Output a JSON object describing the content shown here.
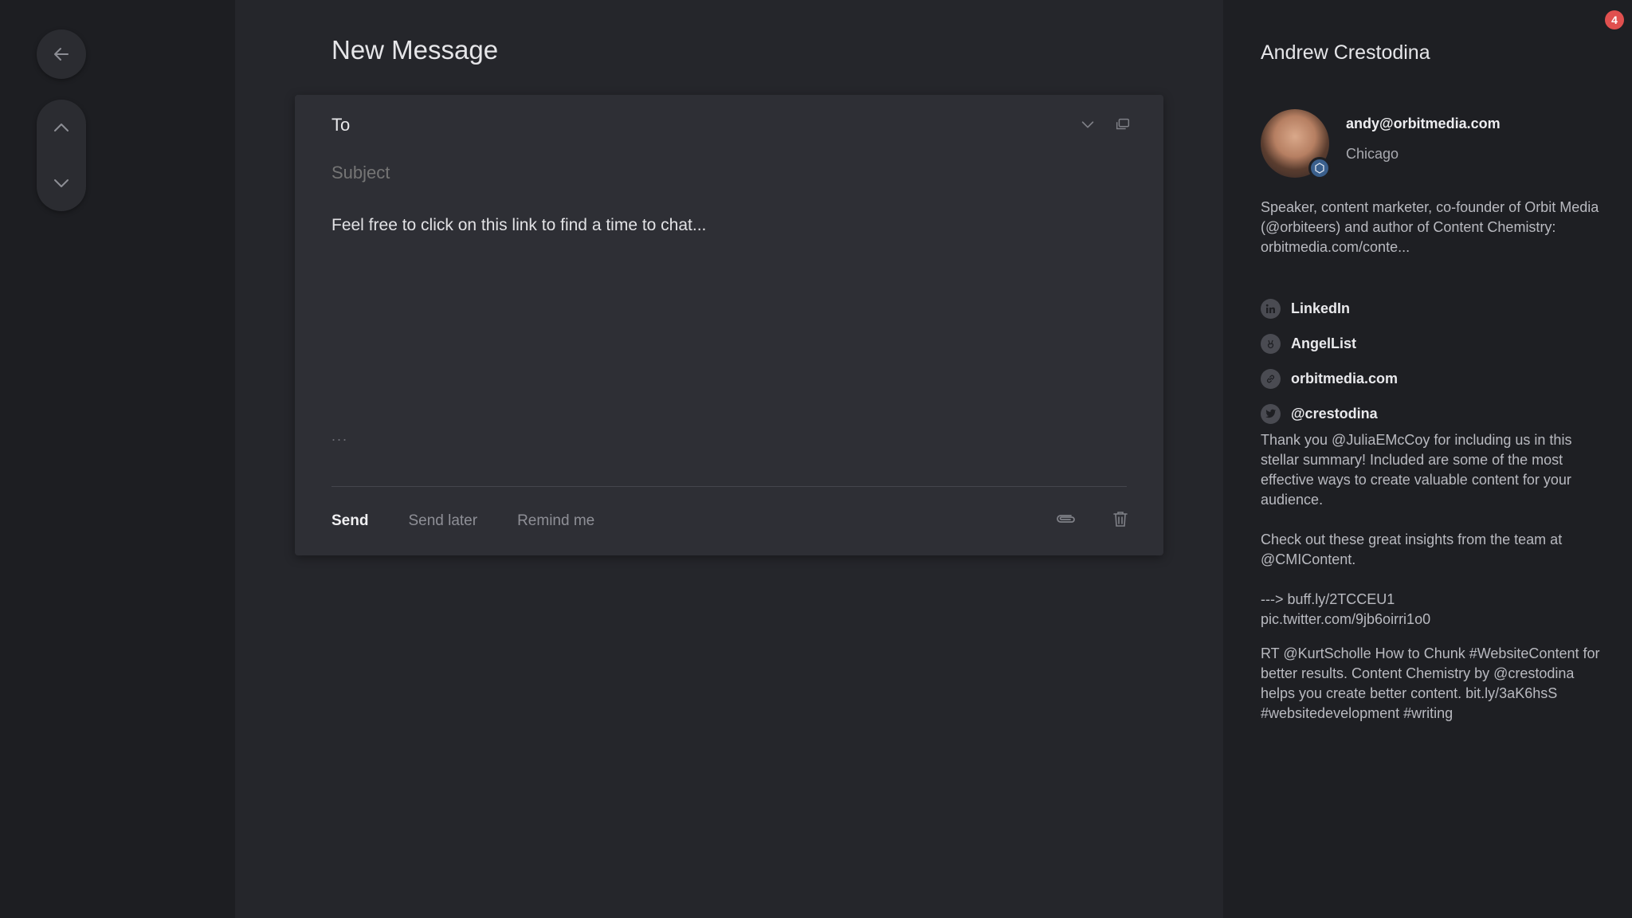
{
  "page_title": "New Message",
  "composer": {
    "to_label": "To",
    "subject_placeholder": "Subject",
    "body": "Feel free to click on this link to find a time to chat...",
    "ellipsis": "...",
    "send_label": "Send",
    "send_later_label": "Send later",
    "remind_me_label": "Remind me"
  },
  "contact": {
    "name": "Andrew Crestodina",
    "email": "andy@orbitmedia.com",
    "location": "Chicago",
    "bio": "Speaker, content marketer, co-founder of Orbit Media (@orbiteers) and author of Content Chemistry: orbitmedia.com/conte...",
    "links": [
      {
        "label": "LinkedIn",
        "icon": "linkedin-icon"
      },
      {
        "label": "AngelList",
        "icon": "angellist-icon"
      },
      {
        "label": "orbitmedia.com",
        "icon": "link-icon"
      },
      {
        "label": "@crestodina",
        "icon": "twitter-icon"
      }
    ],
    "tweets": [
      "Thank you @JuliaEMcCoy for including us in this stellar summary! Included are some of the most effective ways to create valuable content for your audience.\n\nCheck out these great insights from the team at @CMIContent.\n\n---> buff.ly/2TCCEU1\n  pic.twitter.com/9jb6oirri1o0",
      "RT @KurtScholle How to Chunk #WebsiteContent for better results. Content Chemistry by @crestodina helps you create better content. bit.ly/3aK6hsS #websitedevelopment #writing"
    ]
  },
  "notification_count": "4",
  "colors": {
    "background": "#1e1f23",
    "main": "#25262b",
    "composer": "#2e2f35",
    "badge": "#e0504f"
  }
}
